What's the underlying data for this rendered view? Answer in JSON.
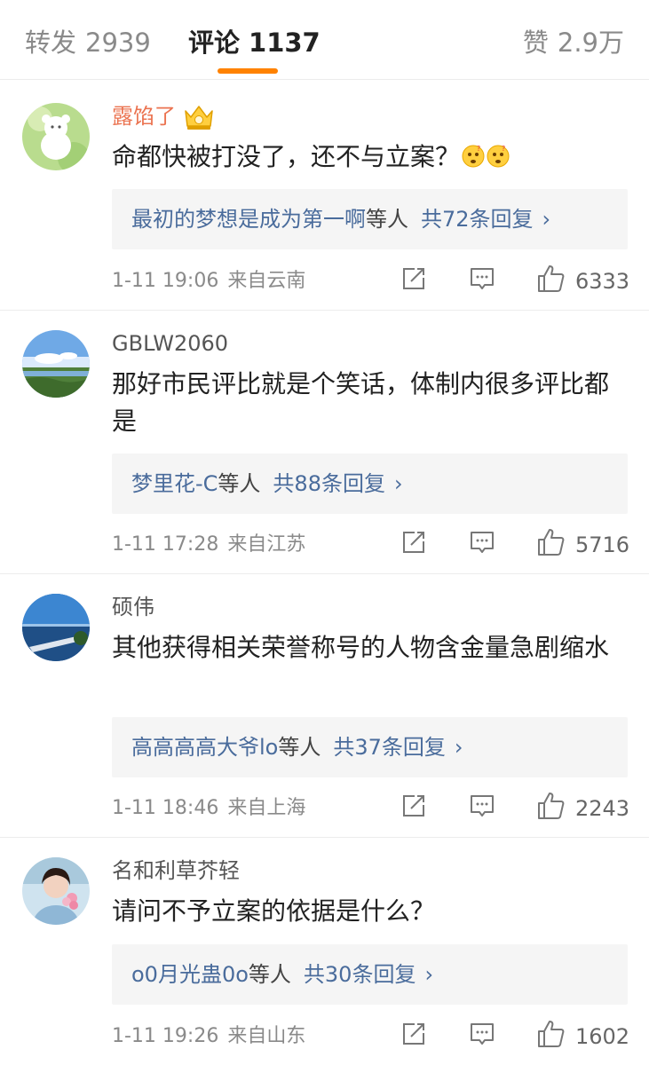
{
  "tabs": {
    "repost": {
      "label": "转发",
      "count": "2939"
    },
    "comments": {
      "label": "评论",
      "count": "1137"
    },
    "likes": {
      "label": "赞",
      "count": "2.9万"
    }
  },
  "colors": {
    "accent": "#ff8200",
    "link": "#4a6c9c",
    "vip_name": "#eb7350"
  },
  "comments": [
    {
      "username": "露馅了",
      "badge": "crown-icon",
      "text": "命都快被打没了，还不与立案？",
      "emojis": [
        "confused-face-icon",
        "confused-face-icon"
      ],
      "reply_preview": {
        "name": "最初的梦想是成为第一啊",
        "suffix": "等人",
        "count": "共72条回复",
        "chevron": "›"
      },
      "time": "1-11 19:06",
      "source": "来自云南",
      "likes": "6333"
    },
    {
      "username": "GBLW2060",
      "text": "那好市民评比就是个笑话，体制内很多评比都是",
      "reply_preview": {
        "name": "梦里花-C",
        "suffix": "等人",
        "count": "共88条回复",
        "chevron": "›"
      },
      "time": "1-11 17:28",
      "source": "来自江苏",
      "likes": "5716"
    },
    {
      "username": "硕伟",
      "text": "其他获得相关荣誉称号的人物含金量急剧缩水",
      "reply_preview": {
        "name": "高高高高大爷lo",
        "suffix": "等人",
        "count": "共37条回复",
        "chevron": "›"
      },
      "time": "1-11 18:46",
      "source": "来自上海",
      "likes": "2243"
    },
    {
      "username": "名和利草芥轻",
      "text": "请问不予立案的依据是什么？",
      "reply_preview": {
        "name": "o0月光蛊0o",
        "suffix": "等人",
        "count": "共30条回复",
        "chevron": "›"
      },
      "time": "1-11 19:26",
      "source": "来自山东",
      "likes": "1602"
    }
  ]
}
